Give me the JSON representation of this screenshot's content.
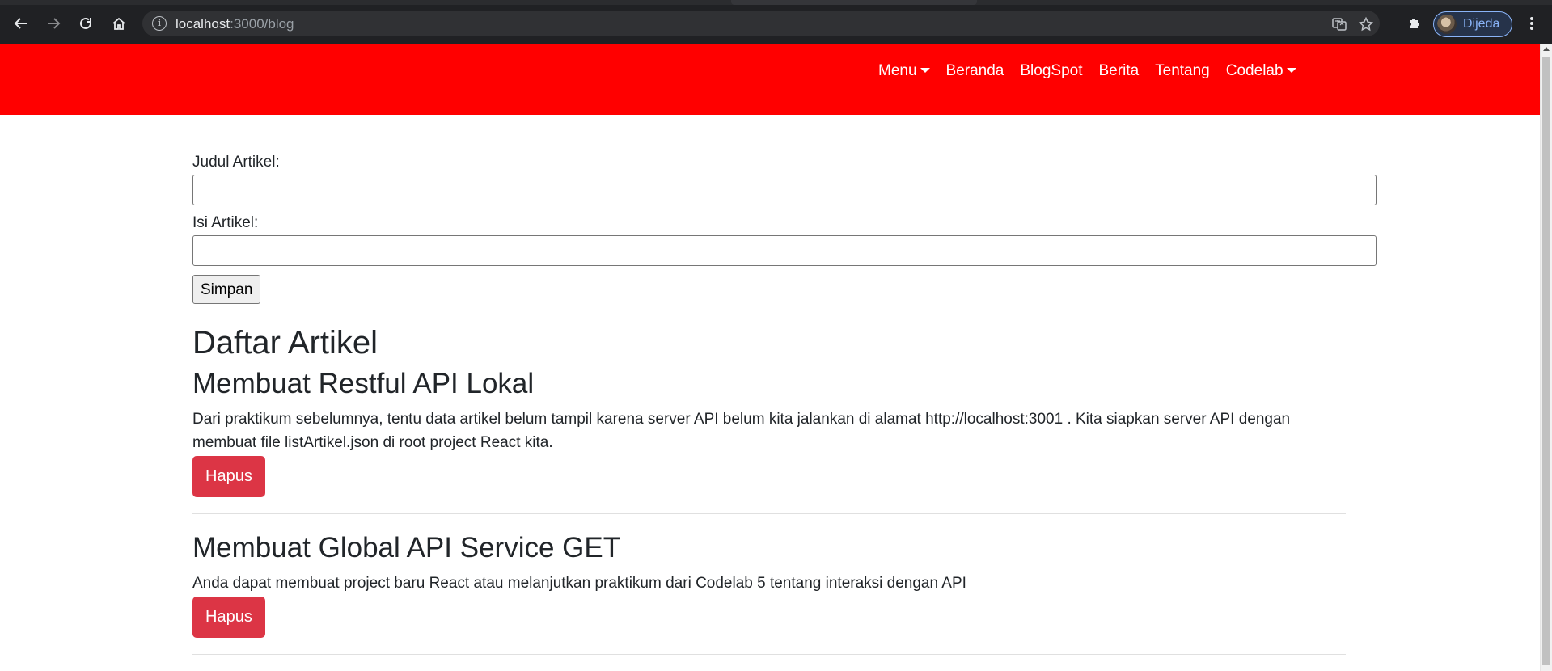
{
  "browser": {
    "url_host": "localhost",
    "url_path": ":3000/blog",
    "profile_name": "Dijeda"
  },
  "nav": {
    "items": [
      {
        "label": "Menu",
        "dropdown": true
      },
      {
        "label": "Beranda",
        "dropdown": false
      },
      {
        "label": "BlogSpot",
        "dropdown": false
      },
      {
        "label": "Berita",
        "dropdown": false
      },
      {
        "label": "Tentang",
        "dropdown": false
      },
      {
        "label": "Codelab",
        "dropdown": true
      }
    ]
  },
  "form": {
    "title_label": "Judul Artikel:",
    "title_value": "",
    "body_label": "Isi Artikel:",
    "body_value": "",
    "submit_label": "Simpan"
  },
  "list": {
    "heading": "Daftar Artikel",
    "articles": [
      {
        "title": "Membuat Restful API Lokal",
        "body": "Dari praktikum sebelumnya, tentu data artikel belum tampil karena server API belum kita jalankan di alamat http://localhost:3001 . Kita siapkan server API dengan membuat file listArtikel.json di root project React kita.",
        "delete_label": "Hapus"
      },
      {
        "title": "Membuat Global API Service GET",
        "body": "Anda dapat membuat project baru React atau melanjutkan praktikum dari Codelab 5 tentang interaksi dengan API",
        "delete_label": "Hapus"
      }
    ]
  },
  "colors": {
    "header_bg": "#ff0000",
    "danger": "#dc3545",
    "chrome_bg": "#202124"
  }
}
